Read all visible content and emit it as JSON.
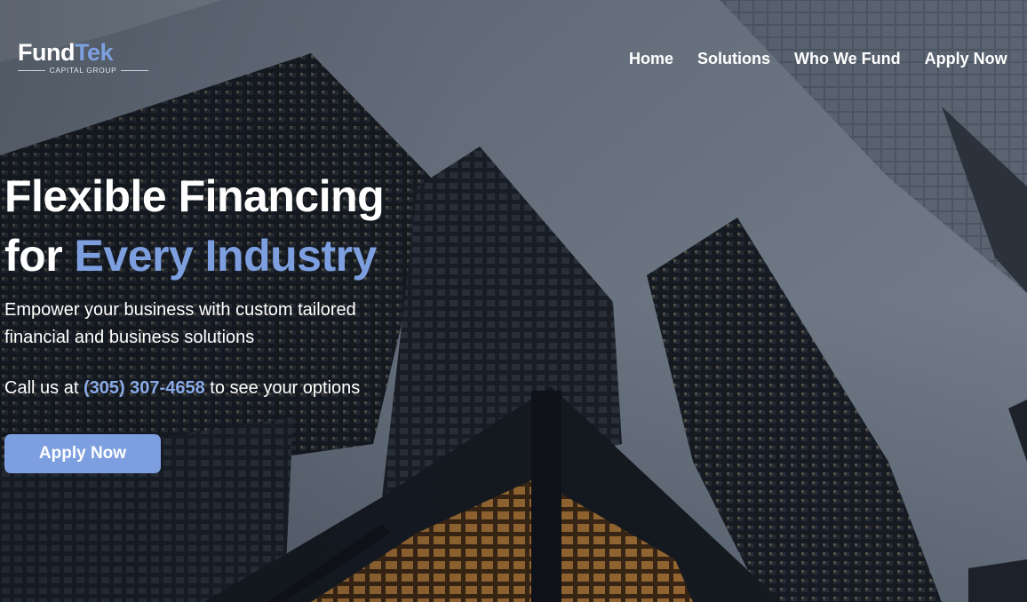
{
  "brand": {
    "name_part1": "Fund",
    "name_part2": "Tek",
    "tagline": "CAPITAL GROUP",
    "accent_color": "#7d9fe0"
  },
  "nav": {
    "items": [
      {
        "label": "Home"
      },
      {
        "label": "Solutions"
      },
      {
        "label": "Who We Fund"
      },
      {
        "label": "Apply Now"
      }
    ]
  },
  "hero": {
    "headline_line1": "Flexible Financing",
    "headline_line2_prefix": "for ",
    "headline_line2_accent": "Every Industry",
    "subheading": "Empower your business with custom tailored financial and business solutions",
    "call_prefix": "Call us at ",
    "phone": "(305) 307-4658",
    "call_suffix": " to see your options",
    "cta_label": "Apply Now",
    "background": "skyscrapers-photo"
  }
}
